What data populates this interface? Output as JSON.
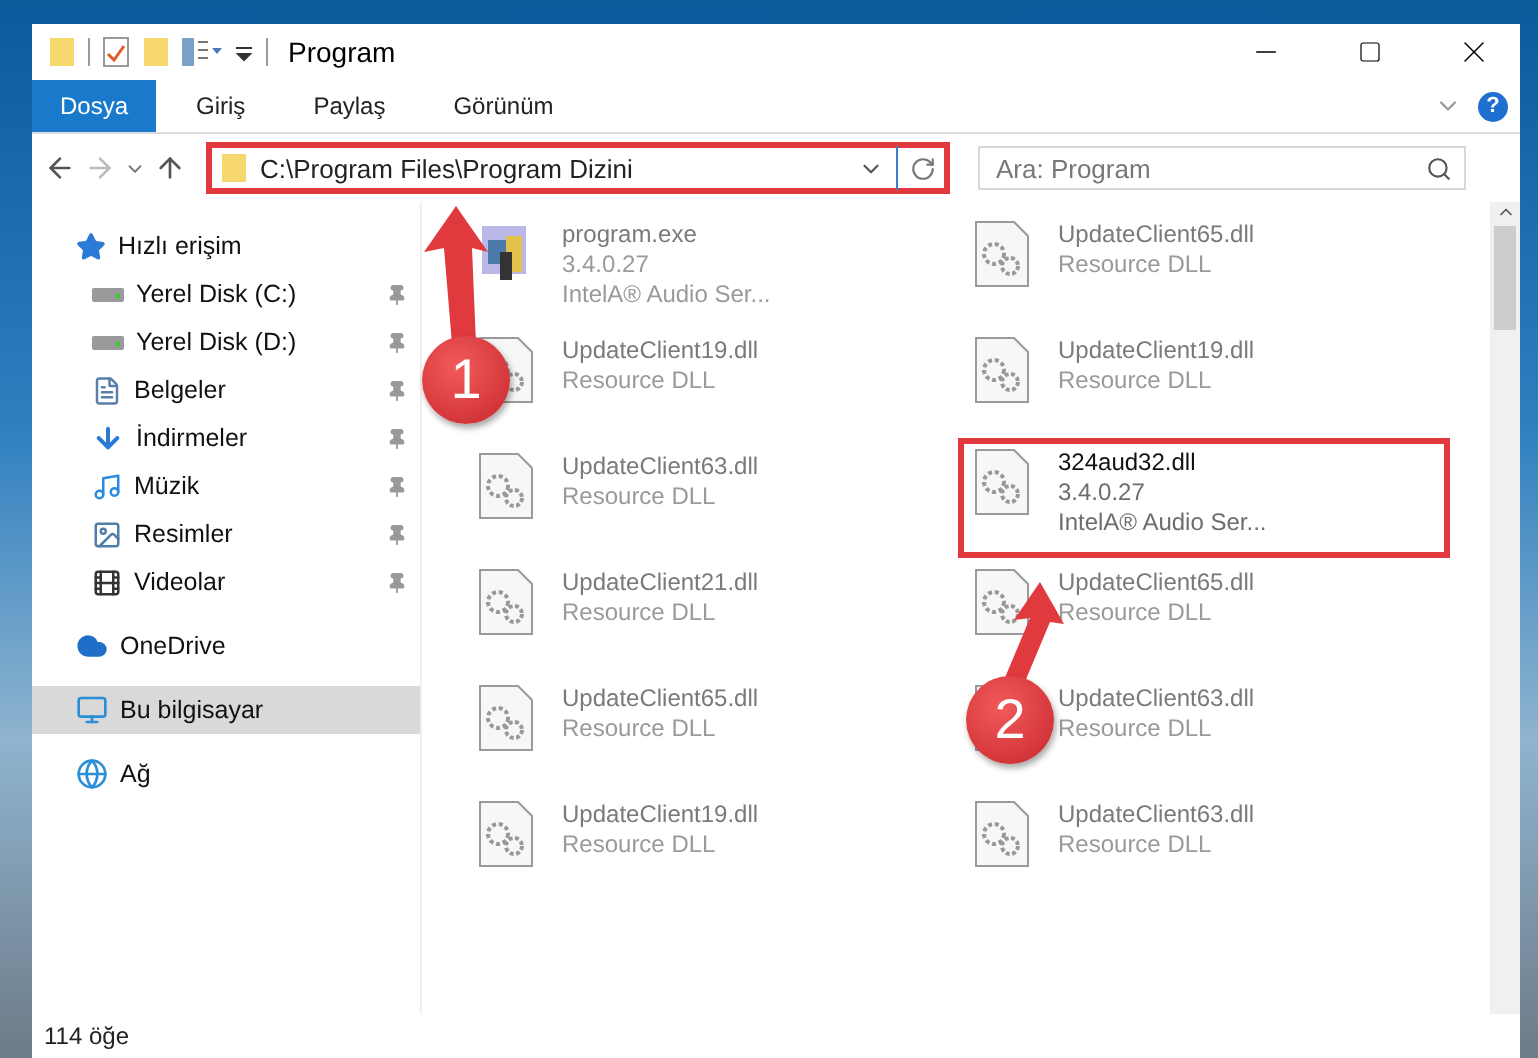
{
  "window": {
    "title": "Program"
  },
  "ribbon": {
    "tabs": [
      {
        "label": "Dosya",
        "selected": true
      },
      {
        "label": "Giriş",
        "selected": false
      },
      {
        "label": "Paylaş",
        "selected": false
      },
      {
        "label": "Görünüm",
        "selected": false
      }
    ],
    "help": "?"
  },
  "address": {
    "path": "C:\\Program Files\\Program Dizini",
    "highlighted": true
  },
  "search": {
    "placeholder": "Ara: Program"
  },
  "sidebar": {
    "items": [
      {
        "label": "Hızlı erişim",
        "kind": "star",
        "selected": false,
        "children": [
          {
            "label": "Yerel Disk (C:)",
            "kind": "drive",
            "selected": false,
            "pinned": true
          },
          {
            "label": "Yerel Disk (D:)",
            "kind": "drive",
            "selected": false,
            "pinned": true
          },
          {
            "label": "Belgeler",
            "kind": "documents",
            "selected": false,
            "pinned": true
          },
          {
            "label": "İndirmeler",
            "kind": "downloads",
            "selected": false,
            "pinned": true
          },
          {
            "label": "Müzik",
            "kind": "music",
            "selected": false,
            "pinned": true
          },
          {
            "label": "Resimler",
            "kind": "pictures",
            "selected": false,
            "pinned": true
          },
          {
            "label": "Videolar",
            "kind": "videos",
            "selected": false,
            "pinned": true
          }
        ]
      },
      {
        "label": "OneDrive",
        "kind": "cloud",
        "selected": false
      },
      {
        "label": "Bu bilgisayar",
        "kind": "computer",
        "selected": true
      },
      {
        "label": "Ağ",
        "kind": "network",
        "selected": false
      }
    ]
  },
  "files": [
    {
      "name": "program.exe",
      "lines": [
        "3.4.0.27",
        "IntelA® Audio Ser..."
      ],
      "kind": "exe",
      "blurred": true,
      "highlighted": false
    },
    {
      "name": "UpdateClient65.dll",
      "lines": [
        "Resource DLL"
      ],
      "kind": "dll",
      "blurred": true,
      "highlighted": false
    },
    {
      "name": "UpdateClient19.dll",
      "lines": [
        "Resource DLL"
      ],
      "kind": "dll",
      "blurred": true,
      "highlighted": false
    },
    {
      "name": "UpdateClient19.dll",
      "lines": [
        "Resource DLL"
      ],
      "kind": "dll",
      "blurred": true,
      "highlighted": false
    },
    {
      "name": "UpdateClient63.dll",
      "lines": [
        "Resource DLL"
      ],
      "kind": "dll",
      "blurred": true,
      "highlighted": false
    },
    {
      "name": "324aud32.dll",
      "lines": [
        "3.4.0.27",
        "IntelA® Audio Ser..."
      ],
      "kind": "dll",
      "blurred": false,
      "highlighted": true
    },
    {
      "name": "UpdateClient21.dll",
      "lines": [
        "Resource DLL"
      ],
      "kind": "dll",
      "blurred": true,
      "highlighted": false
    },
    {
      "name": "UpdateClient65.dll",
      "lines": [
        "Resource DLL"
      ],
      "kind": "dll",
      "blurred": true,
      "highlighted": false
    },
    {
      "name": "UpdateClient65.dll",
      "lines": [
        "Resource DLL"
      ],
      "kind": "dll",
      "blurred": true,
      "highlighted": false
    },
    {
      "name": "UpdateClient63.dll",
      "lines": [
        "Resource DLL"
      ],
      "kind": "dll",
      "blurred": true,
      "highlighted": false
    },
    {
      "name": "UpdateClient19.dll",
      "lines": [
        "Resource DLL"
      ],
      "kind": "dll",
      "blurred": true,
      "highlighted": false
    },
    {
      "name": "UpdateClient63.dll",
      "lines": [
        "Resource DLL"
      ],
      "kind": "dll",
      "blurred": true,
      "highlighted": false
    }
  ],
  "annotations": [
    {
      "number": "1"
    },
    {
      "number": "2"
    }
  ],
  "status_bar": {
    "count": "114 öğe"
  }
}
